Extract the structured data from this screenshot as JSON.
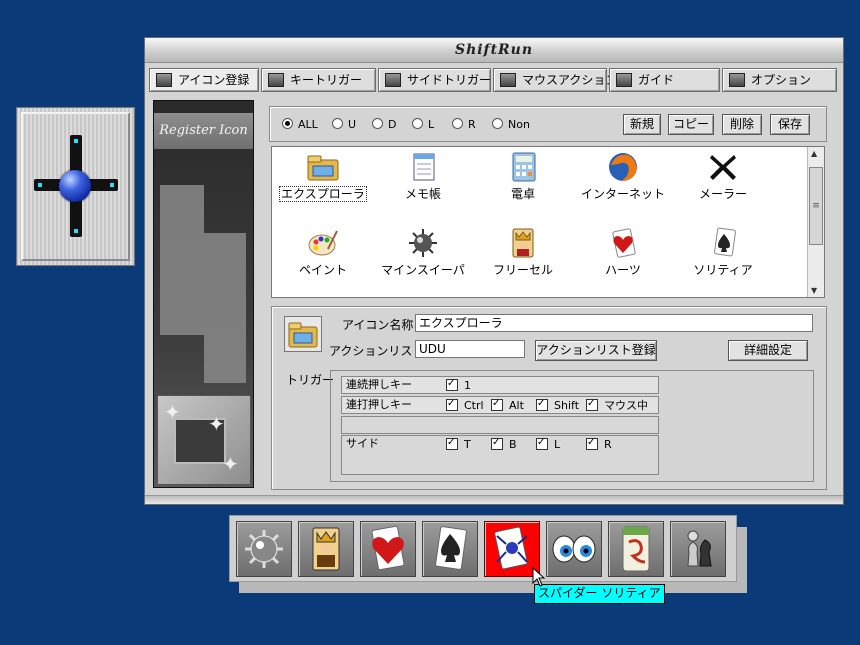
{
  "window": {
    "title": "ShiftRun"
  },
  "tabs": [
    {
      "label": "アイコン登録",
      "icon": "grid-icon",
      "active": true
    },
    {
      "label": "キートリガー",
      "icon": "keyboard-icon"
    },
    {
      "label": "サイドトリガー",
      "icon": "side-trigger-icon"
    },
    {
      "label": "マウスアクション",
      "icon": "mouse-icon"
    },
    {
      "label": "ガイド",
      "icon": "exclamation-icon"
    },
    {
      "label": "オプション",
      "icon": "gear-icon"
    }
  ],
  "left_panel": {
    "title": "Register Icon"
  },
  "filter": {
    "options": [
      "ALL",
      "U",
      "D",
      "L",
      "R",
      "Non"
    ],
    "selected": "ALL",
    "buttons": {
      "new": "新規",
      "copy": "コピー",
      "delete": "削除",
      "save": "保存"
    }
  },
  "icons": [
    {
      "label": "エクスプローラ",
      "icon": "folder-icon",
      "selected": true
    },
    {
      "label": "メモ帳",
      "icon": "notepad-icon"
    },
    {
      "label": "電卓",
      "icon": "calculator-icon"
    },
    {
      "label": "インターネット",
      "icon": "firefox-icon"
    },
    {
      "label": "メーラー",
      "icon": "mailer-icon"
    },
    {
      "label": "ペイント",
      "icon": "paint-icon"
    },
    {
      "label": "マインスイーパ",
      "icon": "mine-icon"
    },
    {
      "label": "フリーセル",
      "icon": "king-card-icon"
    },
    {
      "label": "ハーツ",
      "icon": "heart-card-icon"
    },
    {
      "label": "ソリティア",
      "icon": "spade-card-icon"
    }
  ],
  "detail": {
    "name_label": "アイコン名称",
    "name_value": "エクスプローラ",
    "action_label": "アクションリスト",
    "action_value": "UDU",
    "register_button": "アクションリスト登録",
    "advanced_button": "詳細設定",
    "trigger_label": "トリガー",
    "rows": {
      "hold": {
        "label": "連続押しキー",
        "values": [
          "1"
        ]
      },
      "rapid": {
        "label": "連打押しキー",
        "values": [
          "Ctrl",
          "Alt",
          "Shift",
          "マウス中"
        ]
      },
      "side": {
        "label": "サイド",
        "values": [
          "T",
          "B",
          "L",
          "R"
        ]
      }
    }
  },
  "dock": {
    "items": [
      "mine-icon",
      "king-card-icon",
      "heart-card-icon",
      "spade-card-icon",
      "spider-card-icon",
      "eyes-icon",
      "mahjong-icon",
      "chess-icon"
    ],
    "active_index": 4,
    "tooltip": "スパイダー ソリティア"
  },
  "colors": {
    "desktop": "#0a3a78",
    "tooltip": "#00ffff",
    "active_dock": "#ff0000"
  }
}
